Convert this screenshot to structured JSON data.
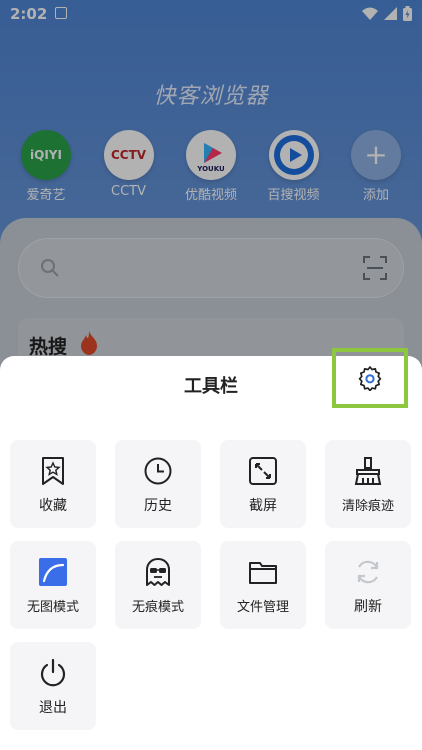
{
  "status": {
    "time": "2:02"
  },
  "brand": {
    "title": "快客浏览器"
  },
  "quick_links": [
    {
      "label": "爱奇艺",
      "logo": "iQIYI"
    },
    {
      "label": "CCTV",
      "logo": "CCTV"
    },
    {
      "label": "优酷视频",
      "logo": "YOUKU"
    },
    {
      "label": "百搜视频",
      "logo": ""
    },
    {
      "label": "添加",
      "logo": "+"
    }
  ],
  "hot": {
    "title": "热搜"
  },
  "toolbar": {
    "title": "工具栏",
    "items": [
      {
        "label": "收藏",
        "icon": "bookmark-icon"
      },
      {
        "label": "历史",
        "icon": "clock-icon"
      },
      {
        "label": "截屏",
        "icon": "screenshot-icon"
      },
      {
        "label": "清除痕迹",
        "icon": "broom-icon"
      },
      {
        "label": "无图模式",
        "icon": "no-image-icon"
      },
      {
        "label": "无痕模式",
        "icon": "ghost-icon"
      },
      {
        "label": "文件管理",
        "icon": "folder-icon"
      },
      {
        "label": "刷新",
        "icon": "refresh-icon"
      },
      {
        "label": "退出",
        "icon": "power-icon"
      }
    ]
  },
  "colors": {
    "highlight": "#8dc63f",
    "settings_icon": "#2f6fd6",
    "accent": "#3a6ee8"
  }
}
